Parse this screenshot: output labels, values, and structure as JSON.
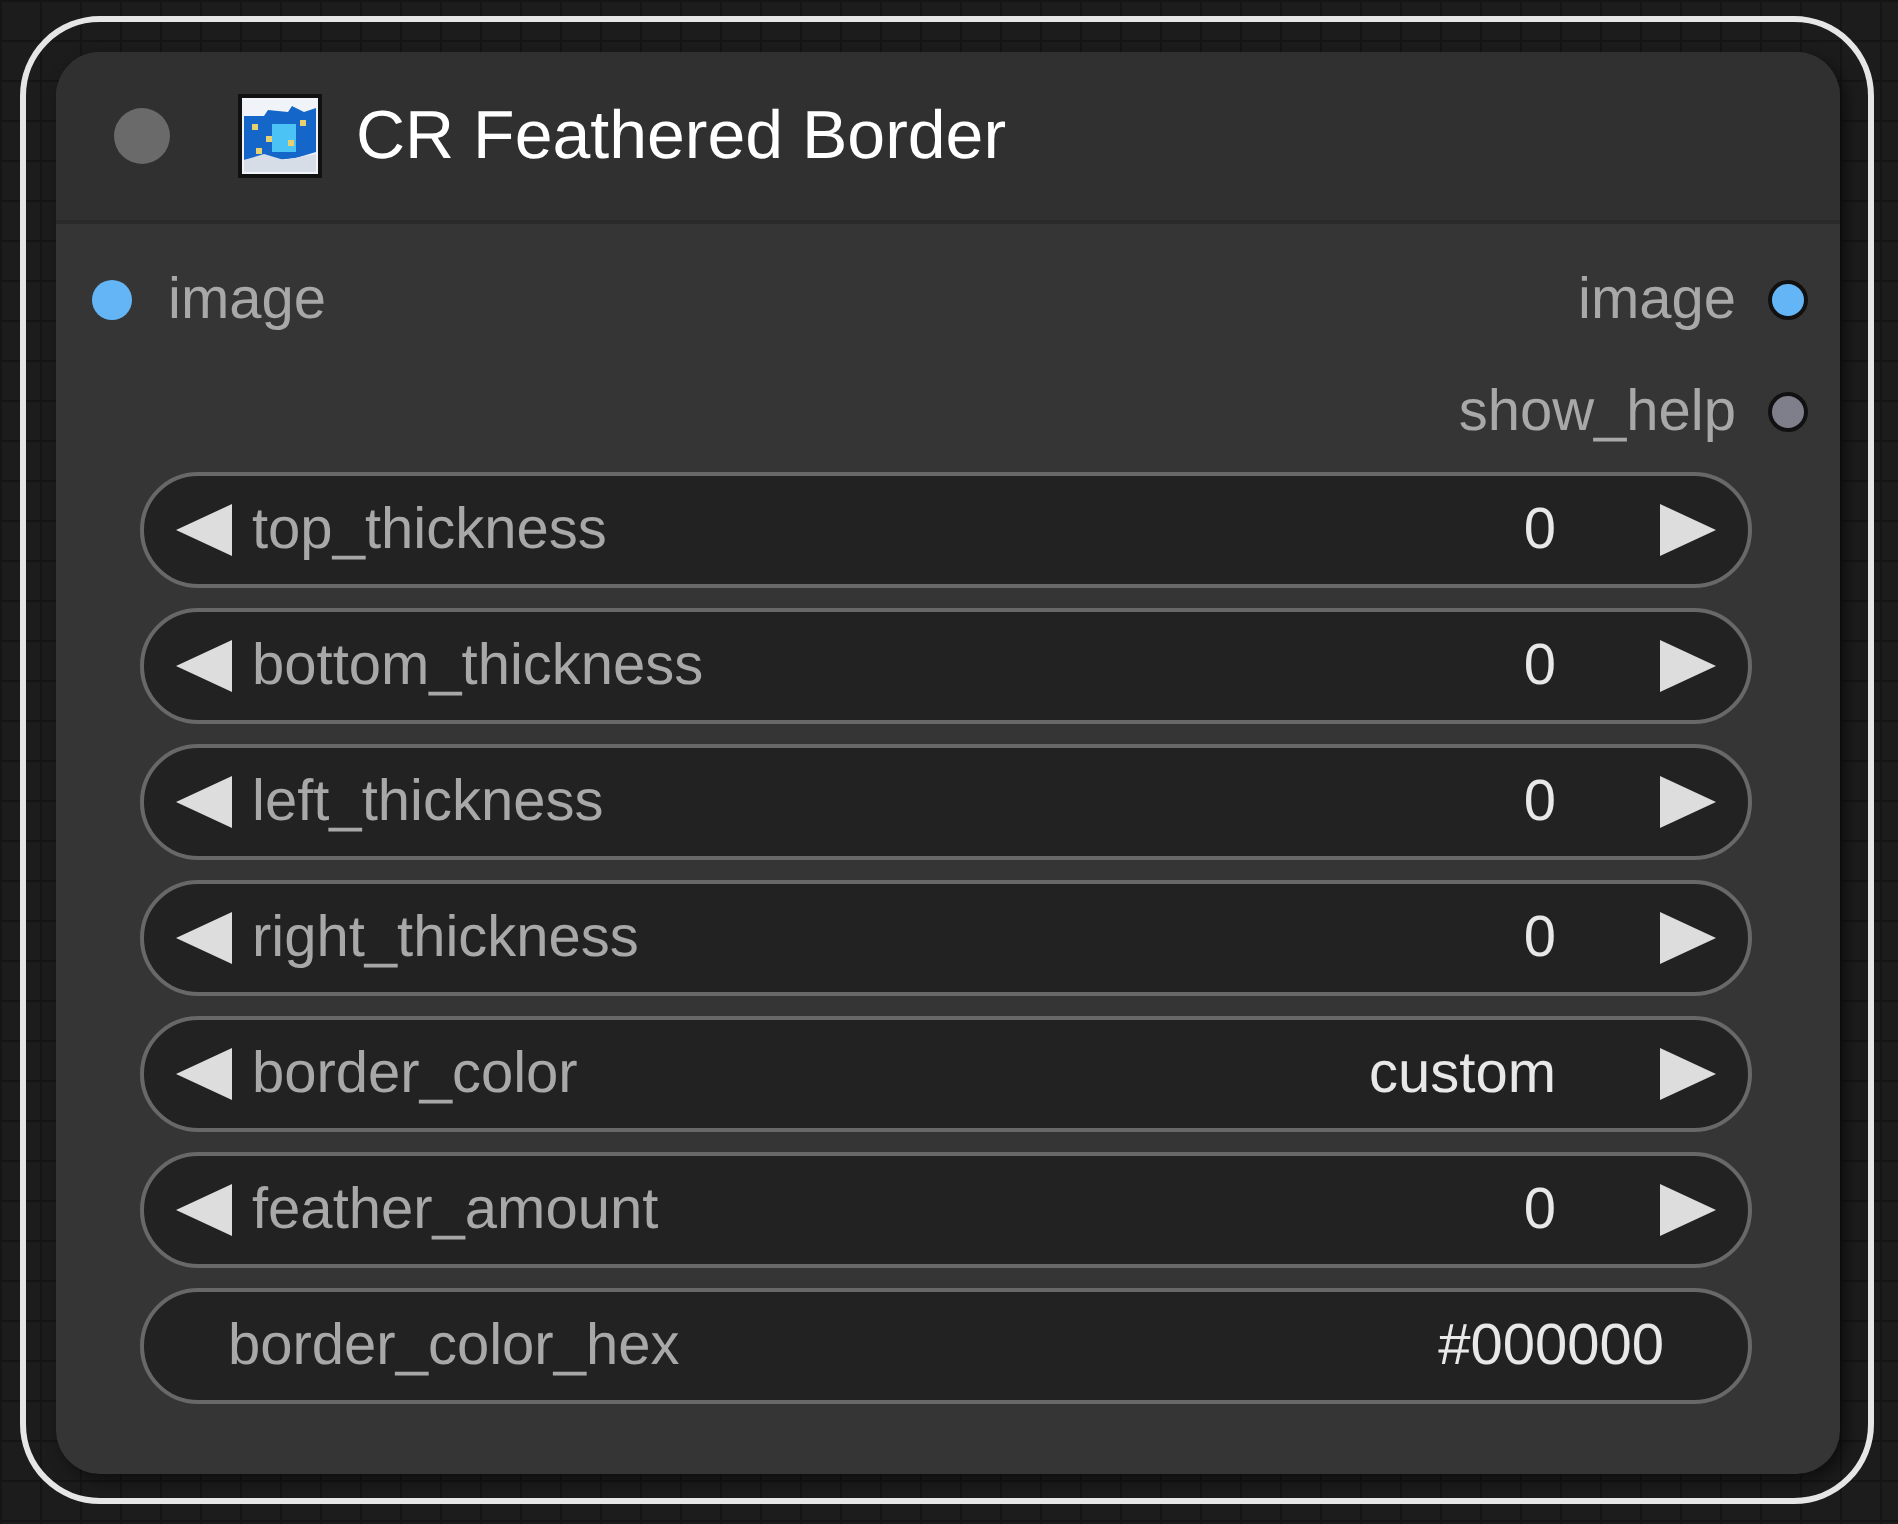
{
  "node": {
    "title": "CR Feathered Border",
    "collapsed": false
  },
  "inputs": [
    {
      "label": "image",
      "color": "#64b5f6"
    }
  ],
  "outputs": [
    {
      "label": "image",
      "color": "#64b5f6"
    },
    {
      "label": "show_help",
      "color": "#7f7f8c"
    }
  ],
  "widgets": [
    {
      "kind": "number",
      "label": "top_thickness",
      "value": "0"
    },
    {
      "kind": "number",
      "label": "bottom_thickness",
      "value": "0"
    },
    {
      "kind": "number",
      "label": "left_thickness",
      "value": "0"
    },
    {
      "kind": "number",
      "label": "right_thickness",
      "value": "0"
    },
    {
      "kind": "combo",
      "label": "border_color",
      "value": "custom"
    },
    {
      "kind": "number",
      "label": "feather_amount",
      "value": "0"
    },
    {
      "kind": "text",
      "label": "border_color_hex",
      "value": "#000000"
    }
  ]
}
